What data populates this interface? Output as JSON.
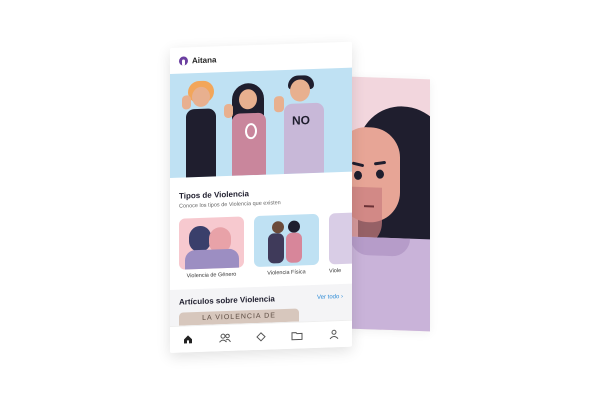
{
  "app": {
    "name": "Aitana"
  },
  "hero": {
    "sign_text": "NO"
  },
  "types_section": {
    "title": "Tipos de Violencia",
    "subtitle": "Conoce los tipos de Violencia que existen",
    "cards": [
      {
        "label": "Violencia de Género"
      },
      {
        "label": "Violencia Física"
      },
      {
        "label": "Viole"
      }
    ]
  },
  "articles_section": {
    "title": "Artículos sobre Violencia",
    "see_all": "Ver todo",
    "first_card_text": "LA VIOLENCIA DE"
  },
  "bottom_nav": [
    "home-icon",
    "users-icon",
    "diamond-icon",
    "folder-icon",
    "profile-icon"
  ],
  "colors": {
    "accent": "#2b8ad6",
    "brand": "#6b3fa0",
    "hero_bg": "#bfe1f3"
  }
}
